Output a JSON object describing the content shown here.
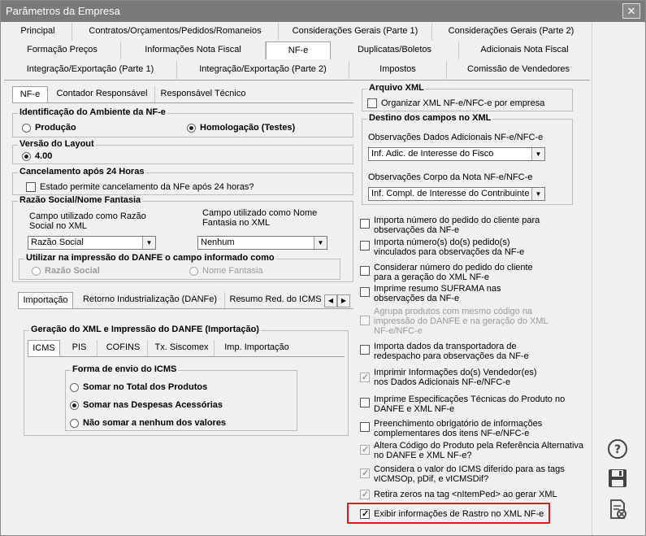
{
  "window": {
    "title": "Parâmetros da Empresa",
    "close_icon": "close-icon"
  },
  "main_tabs": {
    "row1": [
      "Principal",
      "Contratos/Orçamentos/Pedidos/Romaneios",
      "Considerações Gerais (Parte 1)",
      "Considerações Gerais (Parte 2)"
    ],
    "row2": [
      "Formação Preços",
      "Informações Nota Fiscal",
      "NF-e",
      "Duplicatas/Boletos",
      "Adicionais Nota Fiscal"
    ],
    "row3": [
      "Integração/Exportação (Parte 1)",
      "Integração/Exportação (Parte 2)",
      "Impostos",
      "Comissão de Vendedores"
    ]
  },
  "nfe_tabs": [
    "NF-e",
    "Contador Responsável",
    "Responsável Técnico"
  ],
  "identificacao": {
    "title": "Identificação do Ambiente da NF-e",
    "producao": "Produção",
    "homologacao": "Homologação (Testes)"
  },
  "versao": {
    "title": "Versão do Layout",
    "option": "4.00"
  },
  "cancelamento": {
    "title": "Cancelamento após 24 Horas",
    "check": "Estado permite cancelamento da NFe após 24 horas?"
  },
  "razao": {
    "title": "Razão Social/Nome Fantasia",
    "campo_razao_label": "Campo utilizado como Razão Social no XML",
    "campo_razao_value": "Razão Social",
    "campo_fantasia_label": "Campo utilizado como Nome Fantasia no XML",
    "campo_fantasia_value": "Nenhum",
    "danfe_title": "Utilizar na impressão do DANFE o campo informado como",
    "danfe_razao": "Razão Social",
    "danfe_fantasia": "Nome Fantasia"
  },
  "bottom_tabs": [
    "Importação",
    "Retorno Industrialização (DANFe)",
    "Resumo Red. do ICMS"
  ],
  "geracao": {
    "title": "Geração do XML e Impressão do DANFE (Importação)",
    "tabs": [
      "ICMS",
      "PIS",
      "COFINS",
      "Tx. Siscomex",
      "Imp. Importação"
    ],
    "forma_title": "Forma de envio do ICMS",
    "opt1": "Somar no Total dos Produtos",
    "opt2": "Somar nas Despesas Acessórias",
    "opt3": "Não somar a nenhum dos valores"
  },
  "arquivo_xml": {
    "title": "Arquivo XML",
    "check": "Organizar XML NF-e/NFC-e por empresa"
  },
  "destino": {
    "title": "Destino dos campos no XML",
    "obs_adicionais_label": "Observações Dados Adicionais NF-e/NFC-e",
    "obs_adicionais_value": "Inf. Adic. de Interesse do Fisco",
    "obs_corpo_label": "Observações Corpo da Nota NF-e/NFC-e",
    "obs_corpo_value": "Inf. Compl. de Interesse do Contribuinte"
  },
  "options": [
    {
      "text": "Importa número do pedido do cliente para observações da NF-e",
      "checked": false,
      "disabled": false
    },
    {
      "text": "Importa número(s) do(s) pedido(s) vinculados para observações da NF-e",
      "checked": false,
      "disabled": false
    },
    {
      "text": "Considerar número do pedido do cliente para a geração do XML NF-e",
      "checked": false,
      "disabled": false
    },
    {
      "text": "Imprime resumo SUFRAMA nas observações da NF-e",
      "checked": false,
      "disabled": false
    },
    {
      "text": "Agrupa produtos com  mesmo código na impressão do DANFE e na geração do XML NF-e/NFC-e",
      "checked": false,
      "disabled": true
    },
    {
      "text": "Importa dados da transportadora de redespacho para observações da NF-e",
      "checked": false,
      "disabled": false
    },
    {
      "text": "Imprimir Informações do(s) Vendedor(es) nos Dados Adicionais NF-e/NFC-e",
      "checked": true,
      "disabled": true
    },
    {
      "text": "Imprime Especificações Técnicas do Produto no DANFE e XML NF-e",
      "checked": false,
      "disabled": false
    },
    {
      "text": "Preenchimento obrigatório de informações complementares dos itens NF-e/NFC-e",
      "checked": false,
      "disabled": false
    },
    {
      "text": "Altera Código do Produto pela Referência Alternativa no DANFE e XML NF-e?",
      "checked": true,
      "disabled": true
    },
    {
      "text": "Considera o valor do ICMS diferido para as tags vICMSOp, pDif, e vICMSDif?",
      "checked": true,
      "disabled": true
    },
    {
      "text": "Retira zeros na tag <nItemPed> ao gerar XML",
      "checked": true,
      "disabled": true
    },
    {
      "text": "Exibir informações de Rastro no XML NF-e",
      "checked": true,
      "disabled": false
    }
  ],
  "side_icons": [
    "help-icon",
    "save-icon",
    "cancel-document-icon"
  ],
  "colors": {
    "title_bar": "#7a7a7a",
    "highlight": "#e0141e"
  }
}
